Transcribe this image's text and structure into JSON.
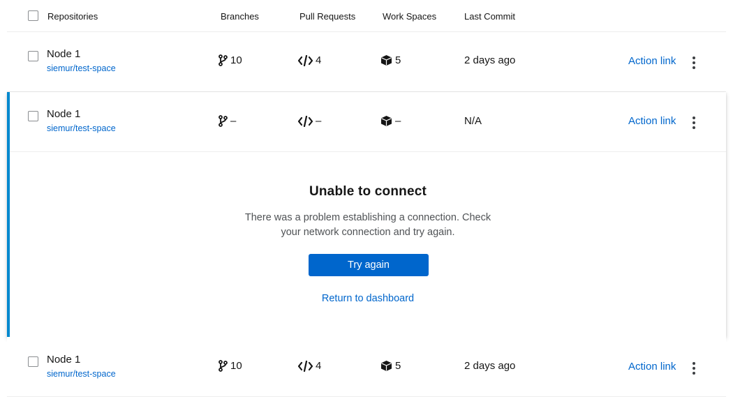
{
  "header": {
    "columns": {
      "repositories": "Repositories",
      "branches": "Branches",
      "pull_requests": "Pull Requests",
      "work_spaces": "Work Spaces",
      "last_commit": "Last Commit"
    }
  },
  "rows": [
    {
      "name": "Node 1",
      "link": "siemur/test-space",
      "branches": "10",
      "pull_requests": "4",
      "work_spaces": "5",
      "last_commit": "2 days ago",
      "action": "Action link"
    },
    {
      "name": "Node 1",
      "link": "siemur/test-space",
      "branches": "–",
      "pull_requests": "–",
      "work_spaces": "–",
      "last_commit": "N/A",
      "action": "Action link"
    },
    {
      "name": "Node 1",
      "link": "siemur/test-space",
      "branches": "10",
      "pull_requests": "4",
      "work_spaces": "5",
      "last_commit": "2 days ago",
      "action": "Action link"
    }
  ],
  "empty_state": {
    "title": "Unable to connect",
    "body": "There was a problem establishing a connection. Check your network connection and try again.",
    "primary_button": "Try again",
    "secondary_link": "Return to dashboard"
  },
  "colors": {
    "accent": "#0066cc",
    "expanded_border": "#0088ce",
    "text": "#151515"
  },
  "icons": {
    "branches": "code-branch-icon",
    "pull_requests": "code-icon",
    "work_spaces": "cube-icon",
    "kebab": "kebab-menu-icon"
  }
}
